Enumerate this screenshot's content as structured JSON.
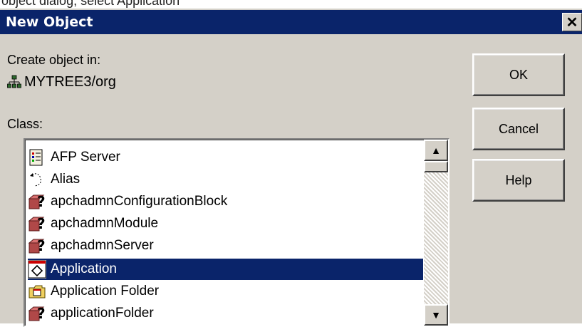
{
  "top_text": "object dialog, select Application",
  "dialog": {
    "title": "New Object",
    "close_glyph": "✕",
    "create_in_label": "Create object in:",
    "create_in_path": "MYTREE3/org",
    "class_label": "Class:",
    "buttons": {
      "ok": "OK",
      "cancel": "Cancel",
      "help": "Help"
    },
    "classes": [
      {
        "label": "AFP Server",
        "icon": "afp-server-icon",
        "selected": false
      },
      {
        "label": "Alias",
        "icon": "alias-icon",
        "selected": false
      },
      {
        "label": "apchadmnConfigurationBlock",
        "icon": "unknown-object-icon",
        "selected": false
      },
      {
        "label": "apchadmnModule",
        "icon": "unknown-object-icon",
        "selected": false
      },
      {
        "label": "apchadmnServer",
        "icon": "unknown-object-icon",
        "selected": false
      },
      {
        "label": "Application",
        "icon": "application-icon",
        "selected": true
      },
      {
        "label": "Application Folder",
        "icon": "application-folder-icon",
        "selected": false
      },
      {
        "label": "applicationFolder",
        "icon": "unknown-object-icon",
        "selected": false
      }
    ]
  },
  "colors": {
    "titlebar": "#0a246a",
    "dialog_bg": "#d4d0c8",
    "selection": "#0a246a"
  }
}
